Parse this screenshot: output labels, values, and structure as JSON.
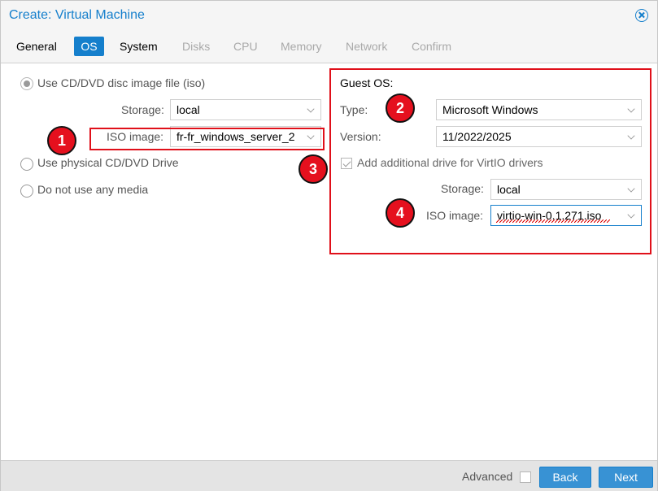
{
  "window": {
    "title": "Create: Virtual Machine"
  },
  "tabs": [
    {
      "label": "General",
      "state": "enabled"
    },
    {
      "label": "OS",
      "state": "active"
    },
    {
      "label": "System",
      "state": "enabled"
    },
    {
      "label": "Disks",
      "state": "disabled"
    },
    {
      "label": "CPU",
      "state": "disabled"
    },
    {
      "label": "Memory",
      "state": "disabled"
    },
    {
      "label": "Network",
      "state": "disabled"
    },
    {
      "label": "Confirm",
      "state": "disabled"
    }
  ],
  "media": {
    "iso_option": "Use CD/DVD disc image file (iso)",
    "storage_label": "Storage:",
    "storage_value": "local",
    "iso_label": "ISO image:",
    "iso_value": "fr-fr_windows_server_2",
    "physical_option": "Use physical CD/DVD Drive",
    "none_option": "Do not use any media"
  },
  "guest_os": {
    "heading": "Guest OS:",
    "type_label": "Type:",
    "type_value": "Microsoft Windows",
    "version_label": "Version:",
    "version_value": "11/2022/2025",
    "virtio_checkbox": "Add additional drive for VirtIO drivers",
    "storage_label": "Storage:",
    "storage_value": "local",
    "iso_label": "ISO image:",
    "iso_value": "virtio-win-0.1.271.iso"
  },
  "markers": [
    "1",
    "2",
    "3",
    "4"
  ],
  "footer": {
    "advanced_label": "Advanced",
    "back_label": "Back",
    "next_label": "Next"
  },
  "colors": {
    "accent": "#157fcc",
    "highlight": "#e0101a"
  }
}
